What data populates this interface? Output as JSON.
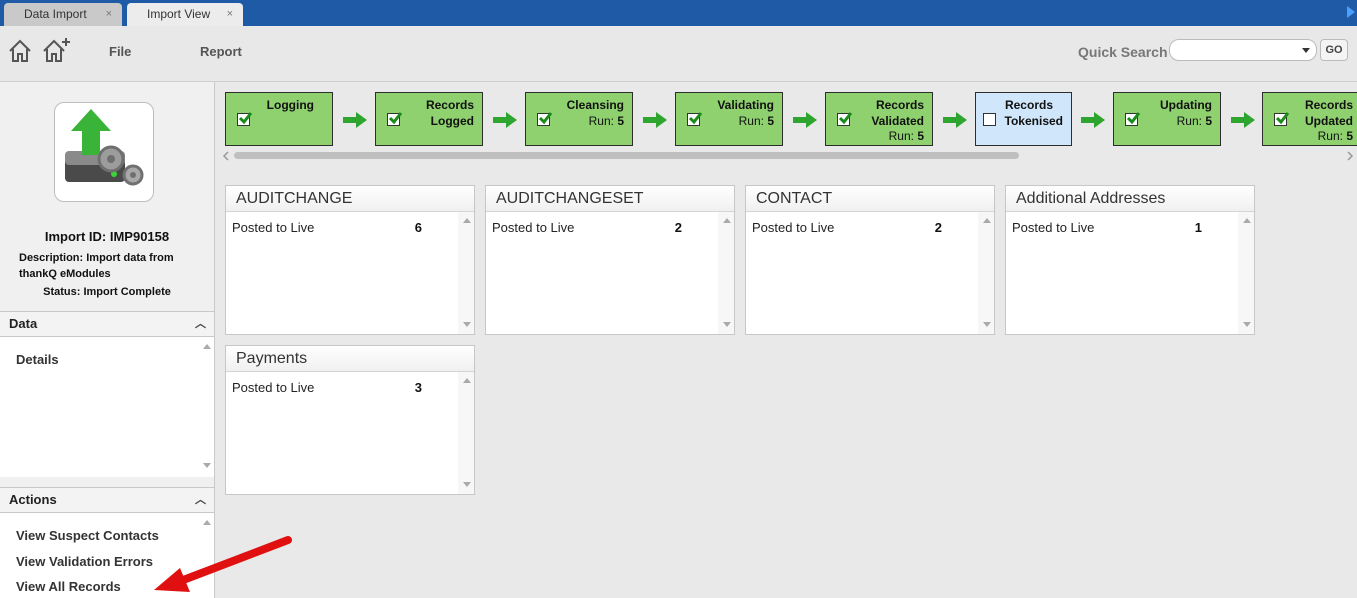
{
  "tabs": [
    {
      "label": "Data Import",
      "close": "×"
    },
    {
      "label": "Import View",
      "close": "×"
    }
  ],
  "toolbar": {
    "menu": [
      "File",
      "Report"
    ],
    "quick_search_label": "Quick Search",
    "quick_search_value": "",
    "go_label": "GO"
  },
  "import_info": {
    "id": "Import ID: IMP90158",
    "description": "Description: Import data from thankQ eModules",
    "status": "Status: Import Complete"
  },
  "data_section": {
    "title": "Data",
    "items": [
      "Details"
    ]
  },
  "actions_section": {
    "title": "Actions",
    "items": [
      "View Suspect Contacts",
      "View Validation Errors",
      "View All Records"
    ]
  },
  "steps": [
    {
      "line1": "Logging",
      "line2": "",
      "run_label": "",
      "run_value": "",
      "checked": true
    },
    {
      "line1": "Records",
      "line2": "Logged",
      "run_label": "",
      "run_value": "",
      "checked": true
    },
    {
      "line1": "Cleansing",
      "line2": "",
      "run_label": "Run:",
      "run_value": "5",
      "checked": true
    },
    {
      "line1": "Validating",
      "line2": "",
      "run_label": "Run:",
      "run_value": "5",
      "checked": true
    },
    {
      "line1": "Records",
      "line2": "Validated",
      "run_label": "Run:",
      "run_value": "5",
      "checked": true
    },
    {
      "line1": "Records",
      "line2": "Tokenised",
      "run_label": "",
      "run_value": "",
      "checked": false
    },
    {
      "line1": "Updating",
      "line2": "",
      "run_label": "Run:",
      "run_value": "5",
      "checked": true
    },
    {
      "line1": "Records",
      "line2": "Updated",
      "run_label": "Run:",
      "run_value": "5",
      "checked": true
    }
  ],
  "cards": [
    {
      "title": "AUDITCHANGE",
      "row_label": "Posted to Live",
      "row_value": "6"
    },
    {
      "title": "AUDITCHANGESET",
      "row_label": "Posted to Live",
      "row_value": "2"
    },
    {
      "title": "CONTACT",
      "row_label": "Posted to Live",
      "row_value": "2"
    },
    {
      "title": "Additional Addresses",
      "row_label": "Posted to Live",
      "row_value": "1"
    },
    {
      "title": "Payments",
      "row_label": "Posted to Live",
      "row_value": "3"
    }
  ],
  "colors": {
    "tabbar": "#1f5aa6",
    "step_done": "#8fd16f",
    "step_current": "#cfe6fb",
    "arrow_green": "#2ea52e",
    "annotation_red": "#e01010"
  }
}
